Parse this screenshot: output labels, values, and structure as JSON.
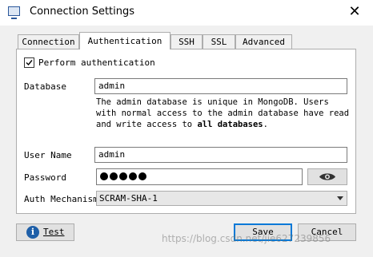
{
  "window": {
    "title": "Connection Settings",
    "close_glyph": "✕"
  },
  "tabs": [
    {
      "label": "Connection",
      "active": false
    },
    {
      "label": "Authentication",
      "active": true
    },
    {
      "label": "SSH",
      "active": false
    },
    {
      "label": "SSL",
      "active": false
    },
    {
      "label": "Advanced",
      "active": false
    }
  ],
  "auth": {
    "perform_label": "Perform authentication",
    "perform_checked": true,
    "database_label": "Database",
    "database_value": "admin",
    "help_text_prefix": "The admin database is unique in MongoDB. Users with normal access to the admin database have read and write access to ",
    "help_text_bold": "all databases",
    "help_text_suffix": ".",
    "username_label": "User Name",
    "username_value": "admin",
    "password_label": "Password",
    "password_mask_count": 5,
    "mechanism_label": "Auth Mechanism",
    "mechanism_value": "SCRAM-SHA-1"
  },
  "footer": {
    "test_label": "Test",
    "save_label": "Save",
    "cancel_label": "Cancel"
  },
  "watermark": "https://blog.csdn.net/jie627239856",
  "icons": [
    "app-window-icon",
    "close-icon",
    "checkbox-check-icon",
    "eye-icon",
    "chevron-down-icon",
    "info-icon"
  ]
}
